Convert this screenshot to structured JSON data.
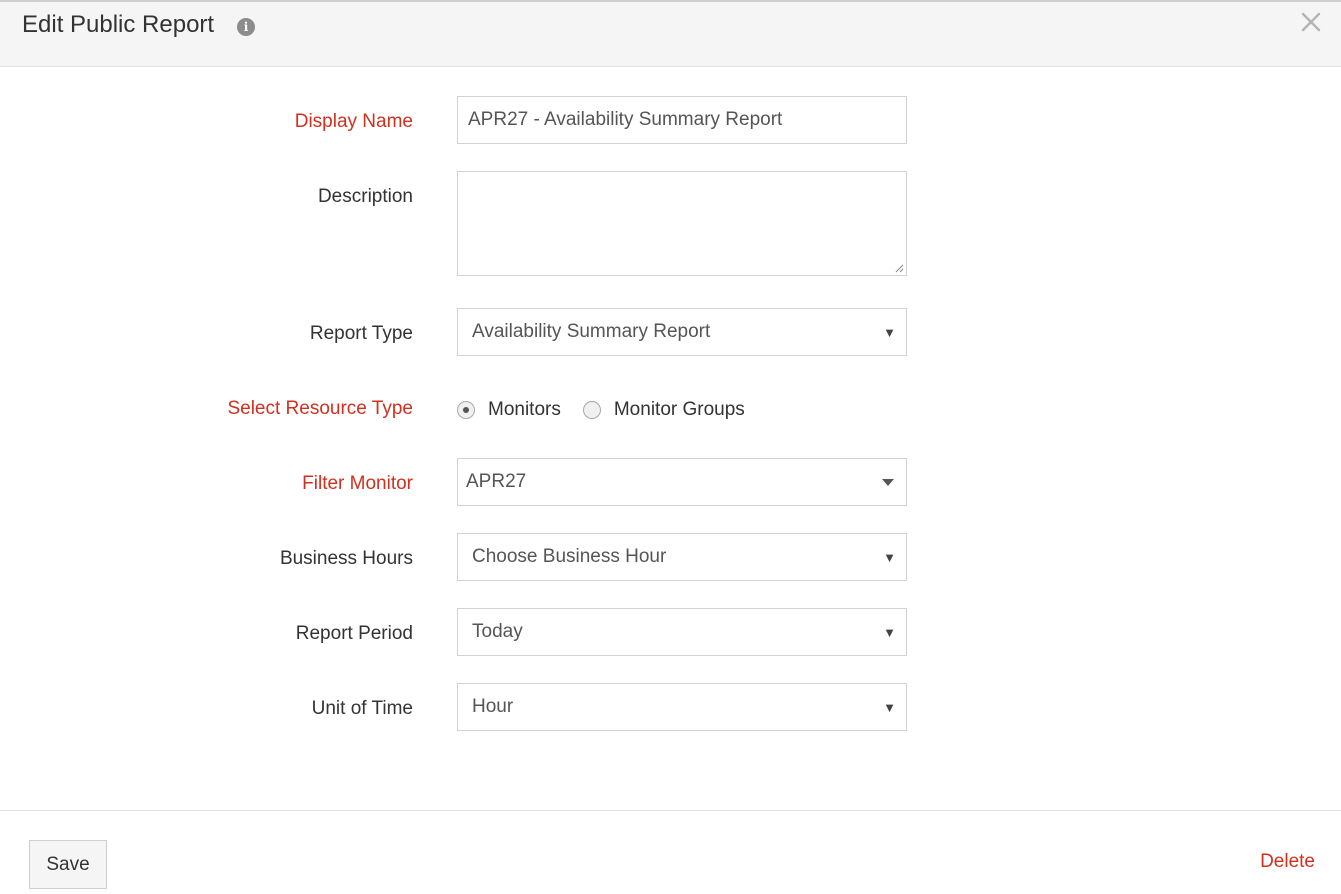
{
  "header": {
    "title": "Edit Public Report",
    "info_icon": "info-icon",
    "info_glyph": "i",
    "close_icon": "close-icon"
  },
  "form": {
    "display_name": {
      "label": "Display Name",
      "value": "APR27 - Availability Summary Report",
      "required": true
    },
    "description": {
      "label": "Description",
      "value": ""
    },
    "report_type": {
      "label": "Report Type",
      "selected": "Availability Summary Report"
    },
    "resource_type": {
      "label": "Select Resource Type",
      "required": true,
      "options": [
        {
          "label": "Monitors",
          "checked": true
        },
        {
          "label": "Monitor Groups",
          "checked": false
        }
      ]
    },
    "filter_monitor": {
      "label": "Filter Monitor",
      "selected": "APR27",
      "required": true
    },
    "business_hours": {
      "label": "Business Hours",
      "selected": "Choose Business Hour"
    },
    "report_period": {
      "label": "Report Period",
      "selected": "Today"
    },
    "unit_of_time": {
      "label": "Unit of Time",
      "selected": "Hour"
    }
  },
  "footer": {
    "save_label": "Save",
    "delete_label": "Delete"
  },
  "colors": {
    "required_label": "#d1301f",
    "header_bg": "#f5f5f5",
    "border": "#d2d2d2"
  }
}
